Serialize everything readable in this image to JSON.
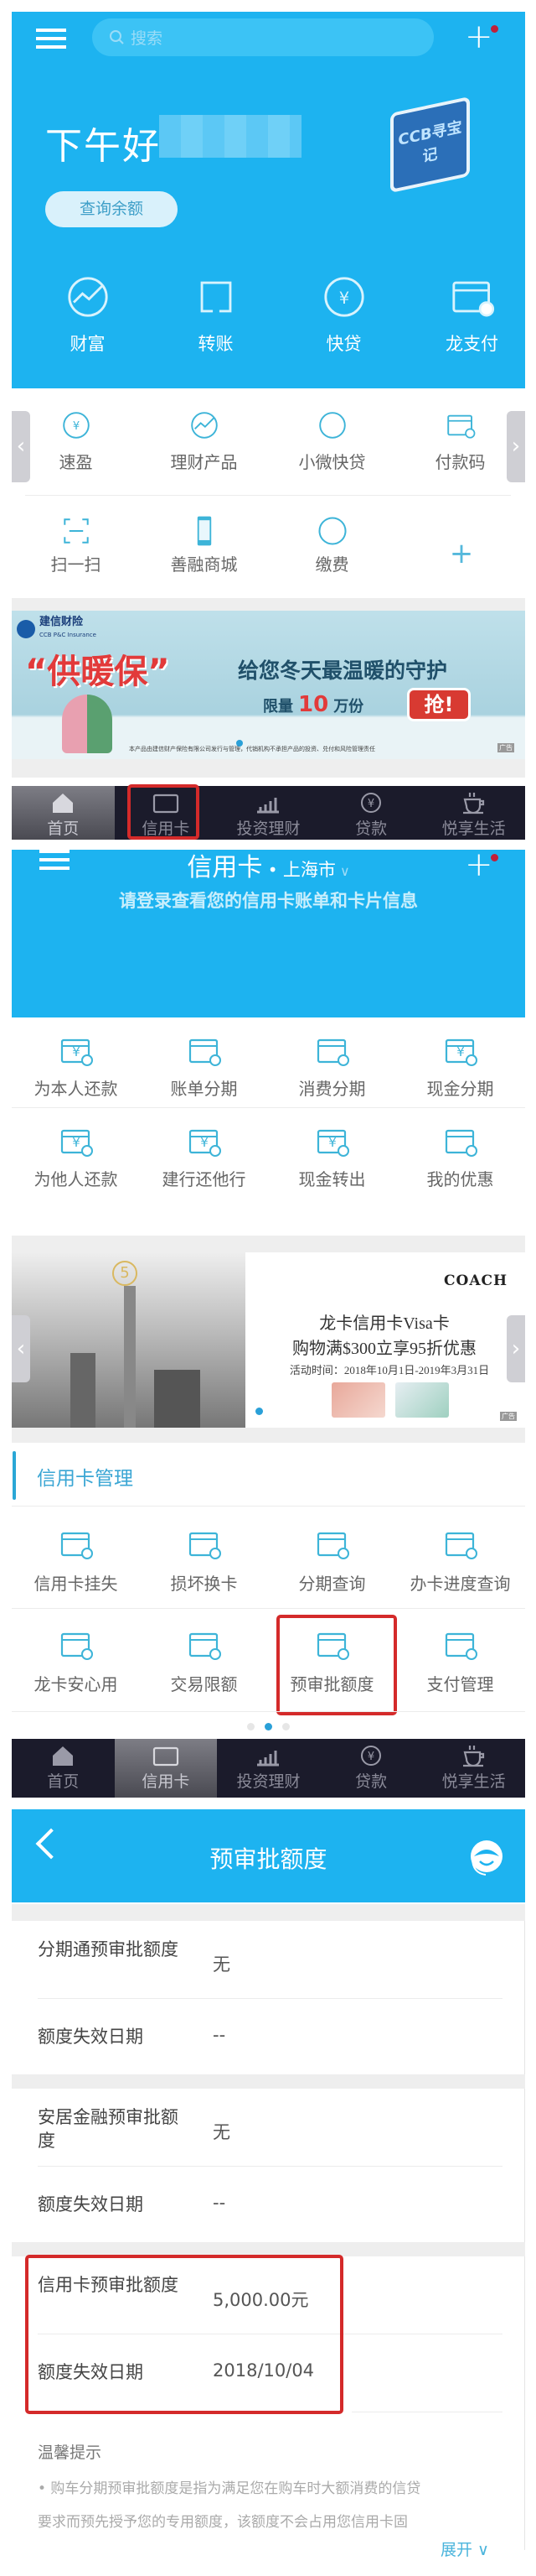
{
  "colors": {
    "primary_blue": "#1db3f0",
    "icon_teal": "#3db4d8",
    "highlight_red": "#d42a2a",
    "tabbar_dark": "#1b1b2b"
  },
  "home": {
    "search_placeholder": "搜索",
    "greeting": "下午好",
    "badge_text": "CCB寻宝记",
    "balance_button": "查询余额",
    "main_actions": [
      {
        "label": "财富",
        "icon": "growth-arrow-icon"
      },
      {
        "label": "转账",
        "icon": "transfer-icon"
      },
      {
        "label": "快贷",
        "icon": "quick-loan-icon"
      },
      {
        "label": "龙支付",
        "icon": "long-pay-icon"
      }
    ],
    "quick_row1": [
      {
        "label": "速盈",
        "icon": "yuan-exchange-icon"
      },
      {
        "label": "理财产品",
        "icon": "trend-icon"
      },
      {
        "label": "小微快贷",
        "icon": "building-icon"
      },
      {
        "label": "付款码",
        "icon": "qr-code-icon"
      }
    ],
    "quick_row2": [
      {
        "label": "扫一扫",
        "icon": "scan-icon"
      },
      {
        "label": "善融商城",
        "icon": "phone-shop-icon"
      },
      {
        "label": "缴费",
        "icon": "water-drop-icon"
      }
    ],
    "banner": {
      "brand": "建信财险",
      "brand_en": "CCB P&C Insurance",
      "headline": "“供暖保”",
      "tagline": "给您冬天最温暖的守护",
      "limit_prefix": "限量",
      "limit_number": "10",
      "limit_suffix": "万份",
      "cta": "抢!",
      "disclaimer": "本产品由建信财产保险有限公司发行与管理，代销机构不承担产品的投资、兑付和风险管理责任",
      "ad_tag": "广告"
    }
  },
  "tabs": [
    {
      "label": "首页",
      "icon": "home-icon"
    },
    {
      "label": "信用卡",
      "icon": "credit-card-icon"
    },
    {
      "label": "投资理财",
      "icon": "bar-chart-icon"
    },
    {
      "label": "贷款",
      "icon": "yuan-circle-icon"
    },
    {
      "label": "悦享生活",
      "icon": "coffee-cup-icon"
    }
  ],
  "credit": {
    "title": "信用卡",
    "city": "上海市",
    "subtitle": "请登录查看您的信用卡账单和卡片信息",
    "row1": [
      {
        "label": "为本人还款",
        "icon": "repay-self-icon"
      },
      {
        "label": "账单分期",
        "icon": "bill-installment-icon"
      },
      {
        "label": "消费分期",
        "icon": "consume-installment-icon"
      },
      {
        "label": "现金分期",
        "icon": "cash-installment-icon"
      }
    ],
    "row2": [
      {
        "label": "为他人还款",
        "icon": "repay-others-icon"
      },
      {
        "label": "建行还他行",
        "icon": "repay-other-bank-icon"
      },
      {
        "label": "现金转出",
        "icon": "cash-out-icon"
      },
      {
        "label": "我的优惠",
        "icon": "coupon-icon"
      }
    ],
    "banner": {
      "brand": "COACH",
      "line1": "龙卡信用卡Visa卡",
      "line2": "购物满$300立享95折优惠",
      "line3": "活动时间：2018年10月1日-2019年3月31日",
      "ad_tag": "广告"
    },
    "section_title": "信用卡管理",
    "mgmt_row1": [
      {
        "label": "信用卡挂失",
        "icon": "report-loss-icon"
      },
      {
        "label": "损坏换卡",
        "icon": "replace-card-icon"
      },
      {
        "label": "分期查询",
        "icon": "installment-query-icon"
      },
      {
        "label": "办卡进度查询",
        "icon": "progress-query-icon"
      }
    ],
    "mgmt_row2": [
      {
        "label": "龙卡安心用",
        "icon": "shield-card-icon"
      },
      {
        "label": "交易限额",
        "icon": "limit-settings-icon"
      },
      {
        "label": "预审批额度",
        "icon": "preapproval-doc-icon"
      },
      {
        "label": "支付管理",
        "icon": "payment-tools-icon"
      }
    ],
    "page_dots": {
      "count": 3,
      "active": 2
    }
  },
  "preapproval": {
    "title": "预审批额度",
    "groups": [
      {
        "limit_label": "分期通预审批额度",
        "limit_value": "无",
        "expiry_label": "额度失效日期",
        "expiry_value": "--"
      },
      {
        "limit_label": "安居金融预审批额度",
        "limit_value": "无",
        "expiry_label": "额度失效日期",
        "expiry_value": "--"
      },
      {
        "limit_label": "信用卡预审批额度",
        "limit_value": "5,000.00元",
        "expiry_label": "额度失效日期",
        "expiry_value": "2018/10/04"
      }
    ],
    "tips_title": "温馨提示",
    "tips_line1": "• 购车分期预审批额度是指为满足您在购车时大额消费的信贷",
    "tips_line2": "要求而预先授予您的专用额度，该额度不会占用您信用卡固",
    "expand_label": "展开"
  }
}
